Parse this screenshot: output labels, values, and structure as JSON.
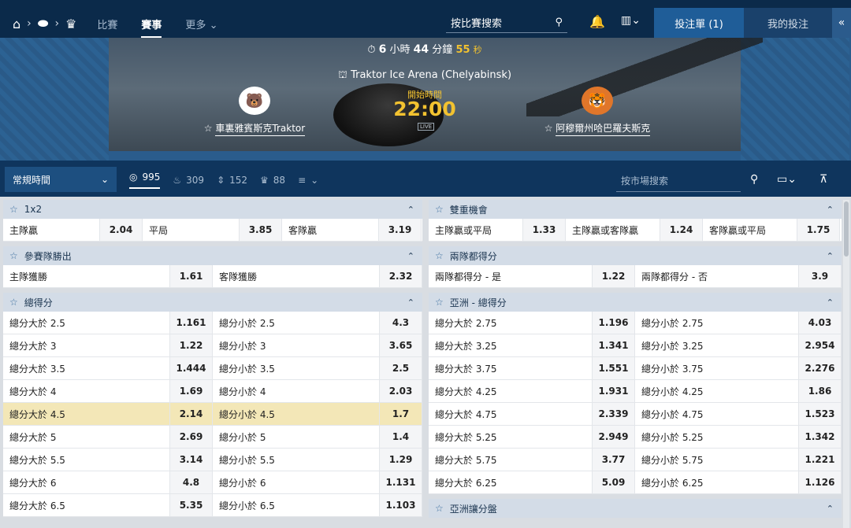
{
  "nav": {
    "links": [
      "比賽",
      "賽事",
      "更多"
    ],
    "active_index": 1,
    "search_placeholder": "按比賽搜索",
    "betslip_label": "投注單 (1)",
    "mybets_label": "我的投注"
  },
  "event": {
    "countdown": {
      "hours": "6",
      "hours_unit": "小時",
      "minutes": "44",
      "minutes_unit": "分鐘",
      "seconds": "55",
      "seconds_unit": "秒"
    },
    "venue": "Traktor Ice Arena (Chelyabinsk)",
    "start_label": "開始時間",
    "start_time": "22:00",
    "live_label": "LIVE",
    "home_team": "車裏雅賓斯克Traktor",
    "away_team": "阿穆爾州哈巴羅夫斯克"
  },
  "filters": {
    "period": "常規時間",
    "counts": [
      "995",
      "309",
      "152",
      "88"
    ],
    "market_search_placeholder": "按市場搜索"
  },
  "left_markets": [
    {
      "title": "1x2",
      "rows": [
        [
          {
            "l": "主隊贏",
            "o": "2.04"
          },
          {
            "l": "平局",
            "o": "3.85"
          },
          {
            "l": "客隊贏",
            "o": "3.19"
          }
        ]
      ]
    },
    {
      "title": "參賽隊勝出",
      "rows": [
        [
          {
            "l": "主隊獲勝",
            "o": "1.61"
          },
          {
            "l": "客隊獲勝",
            "o": "2.32"
          }
        ]
      ]
    },
    {
      "title": "總得分",
      "rows": [
        [
          {
            "l": "總分大於 2.5",
            "o": "1.161"
          },
          {
            "l": "總分小於 2.5",
            "o": "4.3"
          }
        ],
        [
          {
            "l": "總分大於 3",
            "o": "1.22"
          },
          {
            "l": "總分小於 3",
            "o": "3.65"
          }
        ],
        [
          {
            "l": "總分大於 3.5",
            "o": "1.444"
          },
          {
            "l": "總分小於 3.5",
            "o": "2.5"
          }
        ],
        [
          {
            "l": "總分大於 4",
            "o": "1.69"
          },
          {
            "l": "總分小於 4",
            "o": "2.03"
          }
        ],
        [
          {
            "l": "總分大於 4.5",
            "o": "2.14"
          },
          {
            "l": "總分小於 4.5",
            "o": "1.7"
          }
        ],
        [
          {
            "l": "總分大於 5",
            "o": "2.69"
          },
          {
            "l": "總分小於 5",
            "o": "1.4"
          }
        ],
        [
          {
            "l": "總分大於 5.5",
            "o": "3.14"
          },
          {
            "l": "總分小於 5.5",
            "o": "1.29"
          }
        ],
        [
          {
            "l": "總分大於 6",
            "o": "4.8"
          },
          {
            "l": "總分小於 6",
            "o": "1.131"
          }
        ],
        [
          {
            "l": "總分大於 6.5",
            "o": "5.35"
          },
          {
            "l": "總分小於 6.5",
            "o": "1.103"
          }
        ]
      ],
      "highlight_row": 4
    }
  ],
  "right_markets": [
    {
      "title": "雙重機會",
      "rows": [
        [
          {
            "l": "主隊贏或平局",
            "o": "1.33"
          },
          {
            "l": "主隊贏或客隊贏",
            "o": "1.24"
          },
          {
            "l": "客隊贏或平局",
            "o": "1.75"
          }
        ]
      ]
    },
    {
      "title": "兩隊都得分",
      "rows": [
        [
          {
            "l": "兩隊都得分 - 是",
            "o": "1.22"
          },
          {
            "l": "兩隊都得分 - 否",
            "o": "3.9"
          }
        ]
      ]
    },
    {
      "title": "亞洲 - 總得分",
      "rows": [
        [
          {
            "l": "總分大於 2.75",
            "o": "1.196"
          },
          {
            "l": "總分小於 2.75",
            "o": "4.03"
          }
        ],
        [
          {
            "l": "總分大於 3.25",
            "o": "1.341"
          },
          {
            "l": "總分小於 3.25",
            "o": "2.954"
          }
        ],
        [
          {
            "l": "總分大於 3.75",
            "o": "1.551"
          },
          {
            "l": "總分小於 3.75",
            "o": "2.276"
          }
        ],
        [
          {
            "l": "總分大於 4.25",
            "o": "1.931"
          },
          {
            "l": "總分小於 4.25",
            "o": "1.86"
          }
        ],
        [
          {
            "l": "總分大於 4.75",
            "o": "2.339"
          },
          {
            "l": "總分小於 4.75",
            "o": "1.523"
          }
        ],
        [
          {
            "l": "總分大於 5.25",
            "o": "2.949"
          },
          {
            "l": "總分小於 5.25",
            "o": "1.342"
          }
        ],
        [
          {
            "l": "總分大於 5.75",
            "o": "3.77"
          },
          {
            "l": "總分小於 5.75",
            "o": "1.221"
          }
        ],
        [
          {
            "l": "總分大於 6.25",
            "o": "5.09"
          },
          {
            "l": "總分小於 6.25",
            "o": "1.126"
          }
        ]
      ]
    },
    {
      "title": "亞洲讓分盤",
      "rows": []
    }
  ]
}
